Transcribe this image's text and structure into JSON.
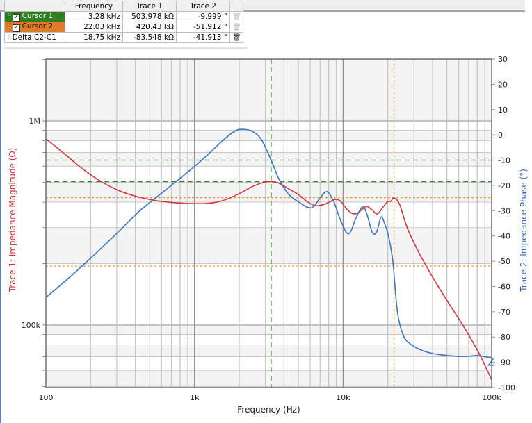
{
  "cursor_table": {
    "headers": [
      "",
      "Frequency",
      "Trace 1",
      "Trace 2",
      ""
    ],
    "rows": [
      {
        "name": "Cursor 1",
        "checked": true,
        "frequency": "3.28 kHz",
        "trace1": "503.978 kΩ",
        "trace2": "-9.999 °",
        "color": "#2e7d1f",
        "delete_icon": "trash-icon"
      },
      {
        "name": "Cursor 2",
        "checked": true,
        "frequency": "22.03 kHz",
        "trace1": "420.43 kΩ",
        "trace2": "-51.912 °",
        "color": "#e07a24",
        "delete_icon": "trash-icon"
      },
      {
        "name": "Delta C2-C1",
        "checked": null,
        "frequency": "18.75 kHz",
        "trace1": "-83.548 kΩ",
        "trace2": "-41.913 °",
        "delete_icon": "trash-icon"
      }
    ],
    "check_glyph": "✓",
    "grip_glyph": "⠿",
    "trash_glyph": "🗑"
  },
  "chart_data": {
    "type": "line",
    "xlabel": "Frequency (Hz)",
    "ylabel_left": "Trace 1: Impedance Magnitude (Ω)",
    "ylabel_right": "Trace 2: Impedance Phase (°)",
    "x_scale": "log",
    "xlim": [
      100,
      100000
    ],
    "x_ticks": [
      {
        "v": 100,
        "label": "100"
      },
      {
        "v": 1000,
        "label": "1k"
      },
      {
        "v": 10000,
        "label": "10k"
      },
      {
        "v": 100000,
        "label": "100k"
      }
    ],
    "y_left_scale": "log",
    "y_left_lim": [
      46000,
      1300000
    ],
    "y_left_ticks": [
      {
        "v": 1000000,
        "label": "1M"
      },
      {
        "v": 100000,
        "label": "100k"
      }
    ],
    "y_right_lim": [
      -100,
      30
    ],
    "y_right_ticks": [
      30,
      20,
      10,
      0,
      -10,
      -20,
      -30,
      -40,
      -50,
      -60,
      -70,
      -80,
      -90,
      -100
    ],
    "grid": true,
    "colors": {
      "trace1": "#d2363f",
      "trace2": "#3d74c0",
      "cursor1": "#2e8b22",
      "cursor2": "#f0903a"
    },
    "series": [
      {
        "name": "Trace 1: Impedance Magnitude",
        "axis": "left",
        "points": [
          [
            100,
            816000
          ],
          [
            130,
            700000
          ],
          [
            170,
            595000
          ],
          [
            220,
            520000
          ],
          [
            300,
            460000
          ],
          [
            400,
            428000
          ],
          [
            550,
            407000
          ],
          [
            750,
            397000
          ],
          [
            1000,
            393000
          ],
          [
            1300,
            396000
          ],
          [
            1600,
            410000
          ],
          [
            2000,
            440000
          ],
          [
            2500,
            480000
          ],
          [
            3000,
            502000
          ],
          [
            3300,
            504000
          ],
          [
            3700,
            495000
          ],
          [
            4300,
            465000
          ],
          [
            5000,
            436000
          ],
          [
            5800,
            400000
          ],
          [
            6600,
            384000
          ],
          [
            7600,
            392000
          ],
          [
            8800,
            412000
          ],
          [
            9600,
            405000
          ],
          [
            10500,
            372000
          ],
          [
            11500,
            352000
          ],
          [
            12500,
            353000
          ],
          [
            13500,
            370000
          ],
          [
            14500,
            381000
          ],
          [
            15700,
            366000
          ],
          [
            17000,
            350000
          ],
          [
            18500,
            377000
          ],
          [
            19800,
            400000
          ],
          [
            21000,
            405000
          ],
          [
            22030,
            420000
          ],
          [
            24000,
            390000
          ],
          [
            27000,
            300000
          ],
          [
            32000,
            230000
          ],
          [
            40000,
            172000
          ],
          [
            50000,
            132000
          ],
          [
            65000,
            98000
          ],
          [
            82000,
            73000
          ],
          [
            100000,
            54000
          ]
        ]
      },
      {
        "name": "Trace 2: Impedance Phase",
        "axis": "right",
        "points": [
          [
            100,
            -64.3
          ],
          [
            150,
            -55.5
          ],
          [
            220,
            -46.5
          ],
          [
            300,
            -39
          ],
          [
            420,
            -30.5
          ],
          [
            560,
            -24.5
          ],
          [
            750,
            -18.5
          ],
          [
            1000,
            -12.5
          ],
          [
            1300,
            -6.5
          ],
          [
            1600,
            -1.5
          ],
          [
            1900,
            1.7
          ],
          [
            2100,
            2.2
          ],
          [
            2400,
            1.6
          ],
          [
            2800,
            -1.6
          ],
          [
            3280,
            -10
          ],
          [
            3700,
            -17.5
          ],
          [
            4300,
            -23.5
          ],
          [
            5000,
            -26.5
          ],
          [
            5700,
            -28.5
          ],
          [
            6300,
            -28.5
          ],
          [
            7100,
            -24.5
          ],
          [
            7800,
            -22.5
          ],
          [
            8600,
            -26
          ],
          [
            9500,
            -33
          ],
          [
            10500,
            -38.5
          ],
          [
            11200,
            -38.5
          ],
          [
            12200,
            -33
          ],
          [
            13500,
            -28.5
          ],
          [
            14500,
            -31.5
          ],
          [
            15700,
            -38.5
          ],
          [
            16800,
            -38.5
          ],
          [
            18000,
            -32.5
          ],
          [
            19000,
            -35
          ],
          [
            20000,
            -39
          ],
          [
            21000,
            -45
          ],
          [
            21800,
            -52
          ],
          [
            22500,
            -62
          ],
          [
            23500,
            -72
          ],
          [
            25500,
            -79.5
          ],
          [
            28000,
            -82.5
          ],
          [
            33000,
            -85
          ],
          [
            40000,
            -86.5
          ],
          [
            50000,
            -87.3
          ],
          [
            65000,
            -87.7
          ],
          [
            80000,
            -87.3
          ],
          [
            90000,
            -87.8
          ],
          [
            100000,
            -88.2
          ]
        ]
      }
    ],
    "cursors": [
      {
        "name": "Cursor 1",
        "frequency": 3280,
        "magnitude": 503978,
        "phase": -9.999,
        "style": "dashed"
      },
      {
        "name": "Cursor 2",
        "frequency": 22030,
        "magnitude": 420430,
        "phase": -51.912,
        "style": "dotted"
      }
    ],
    "right_edge_marker": {
      "phase": -90,
      "glyph": "∠"
    }
  }
}
